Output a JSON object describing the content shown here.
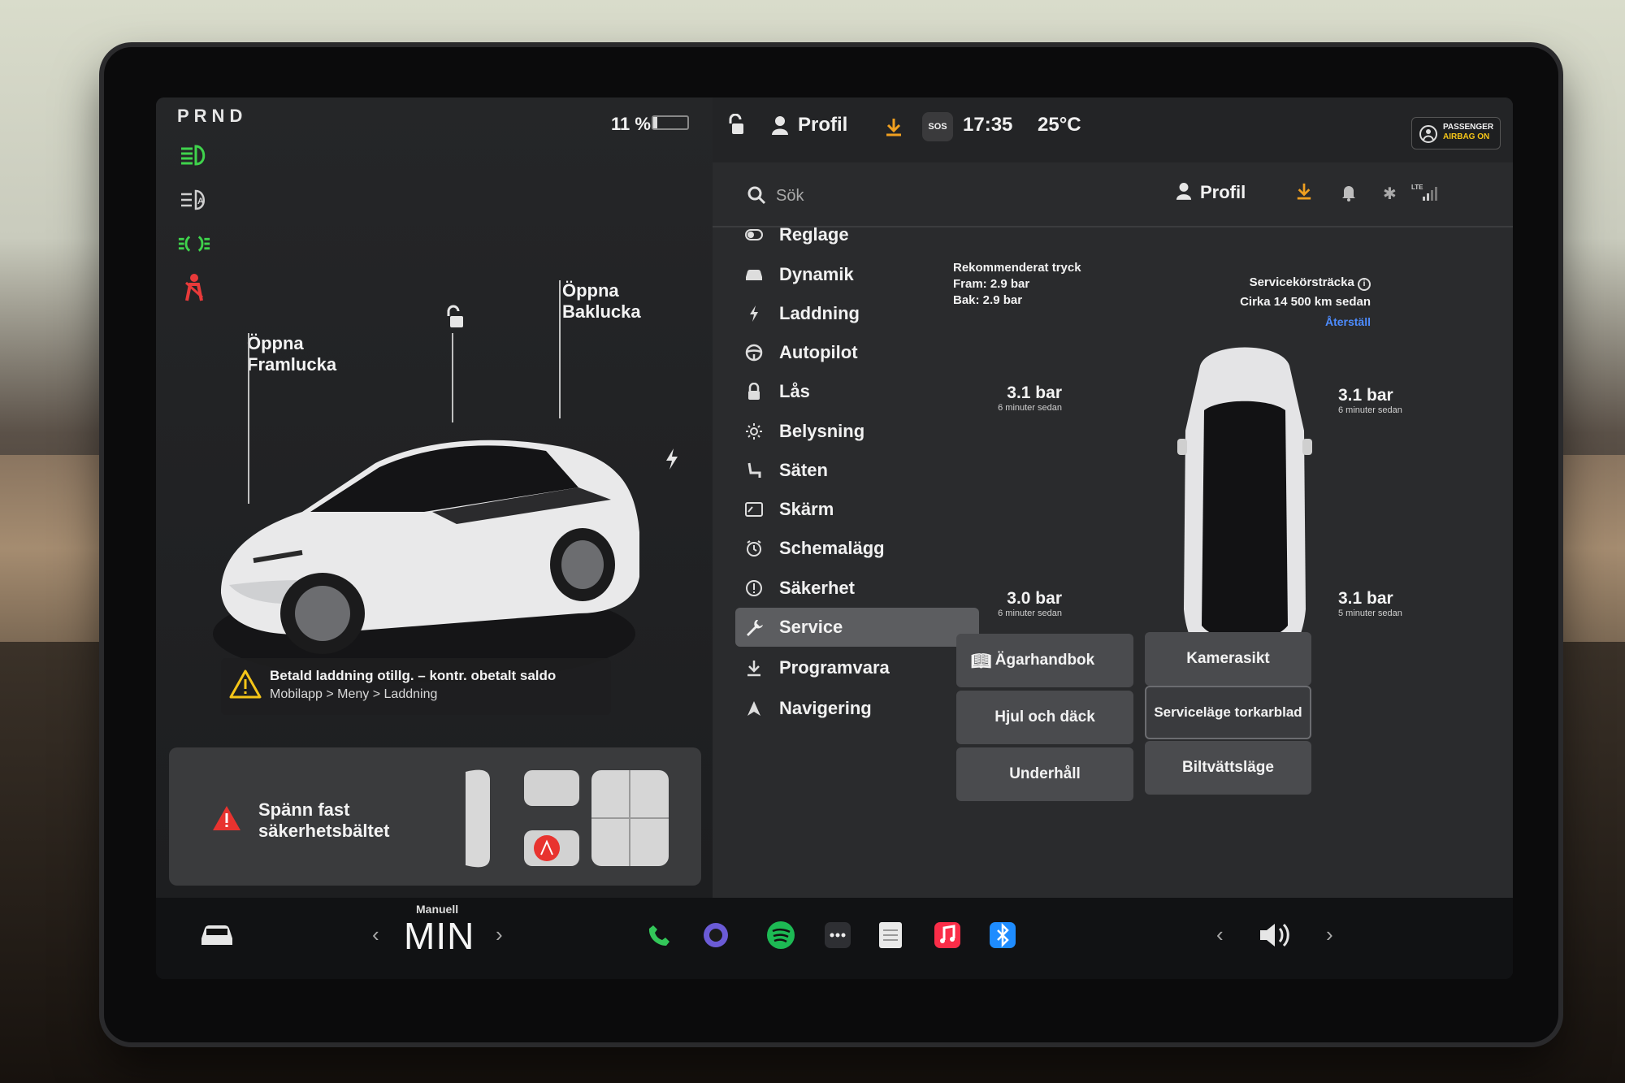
{
  "gear": "PRND",
  "battery": {
    "percent_label": "11 %",
    "percent": 11
  },
  "telltales": [
    {
      "name": "headlight-icon",
      "color": "#3fd34c"
    },
    {
      "name": "auto-headlight-icon",
      "color": "#d0d0d0"
    },
    {
      "name": "parking-light-icon",
      "color": "#3fd34c"
    },
    {
      "name": "seatbelt-warning-icon",
      "color": "#e83a3a"
    }
  ],
  "car_view": {
    "frunk_label": "Öppna\nFramlucka",
    "trunk_label": "Öppna\nBaklucka"
  },
  "warning": {
    "title": "Betald laddning otillg. – kontr. obetalt saldo",
    "subtitle": "Mobilapp > Meny > Laddning"
  },
  "seatbelt_card": {
    "text": "Spänn fast\nsäkerhetsbältet"
  },
  "status": {
    "profile": "Profil",
    "sos": "SOS",
    "time": "17:35",
    "temp": "25°C",
    "airbag_line1": "PASSENGER",
    "airbag_line2": "AIRBAG ON"
  },
  "search": {
    "placeholder": "Sök",
    "profile": "Profil"
  },
  "menu": [
    {
      "icon": "toggle-icon",
      "label": "Reglage"
    },
    {
      "icon": "car-icon",
      "label": "Dynamik"
    },
    {
      "icon": "bolt-icon",
      "label": "Laddning"
    },
    {
      "icon": "steering-wheel-icon",
      "label": "Autopilot"
    },
    {
      "icon": "lock-icon",
      "label": "Lås"
    },
    {
      "icon": "sun-icon",
      "label": "Belysning"
    },
    {
      "icon": "seat-icon",
      "label": "Säten"
    },
    {
      "icon": "screen-icon",
      "label": "Skärm"
    },
    {
      "icon": "clock-icon",
      "label": "Schemalägg"
    },
    {
      "icon": "alert-icon",
      "label": "Säkerhet"
    },
    {
      "icon": "wrench-icon",
      "label": "Service",
      "active": true
    },
    {
      "icon": "download-icon",
      "label": "Programvara"
    },
    {
      "icon": "navigation-icon",
      "label": "Navigering"
    }
  ],
  "service": {
    "rec_title": "Rekommenderat tryck",
    "rec_front": "Fram: 2.9 bar",
    "rec_rear": "Bak: 2.9 bar",
    "dist_title": "Servicekörsträcka",
    "dist_value": "Cirka 14 500 km sedan",
    "dist_reset": "Återställ",
    "tires": {
      "fl": {
        "pressure": "3.1 bar",
        "age": "6 minuter sedan"
      },
      "fr": {
        "pressure": "3.1 bar",
        "age": "6 minuter sedan"
      },
      "rl": {
        "pressure": "3.0 bar",
        "age": "6 minuter sedan"
      },
      "rr": {
        "pressure": "3.1 bar",
        "age": "5 minuter sedan"
      }
    },
    "buttons": {
      "manual": "Ägarhandbok",
      "camera": "Kamerasikt",
      "wheels": "Hjul och däck",
      "wiper": "Serviceläge torkarblad",
      "maintenance": "Underhåll",
      "carwash": "Biltvättsläge"
    }
  },
  "dock": {
    "mode_small": "Manuell",
    "mode": "MIN",
    "apps": [
      {
        "name": "phone-icon",
        "color": "#33c759"
      },
      {
        "name": "camera-app-icon",
        "color": "#6b5bd6"
      },
      {
        "name": "spotify-icon",
        "color": "#1db954"
      },
      {
        "name": "more-apps-icon",
        "color": "#2e2f33"
      },
      {
        "name": "notes-icon",
        "color": "#e9e9e9"
      },
      {
        "name": "music-icon",
        "color": "#fa2d48"
      },
      {
        "name": "bluetooth-icon",
        "color": "#1e8cff"
      }
    ]
  }
}
